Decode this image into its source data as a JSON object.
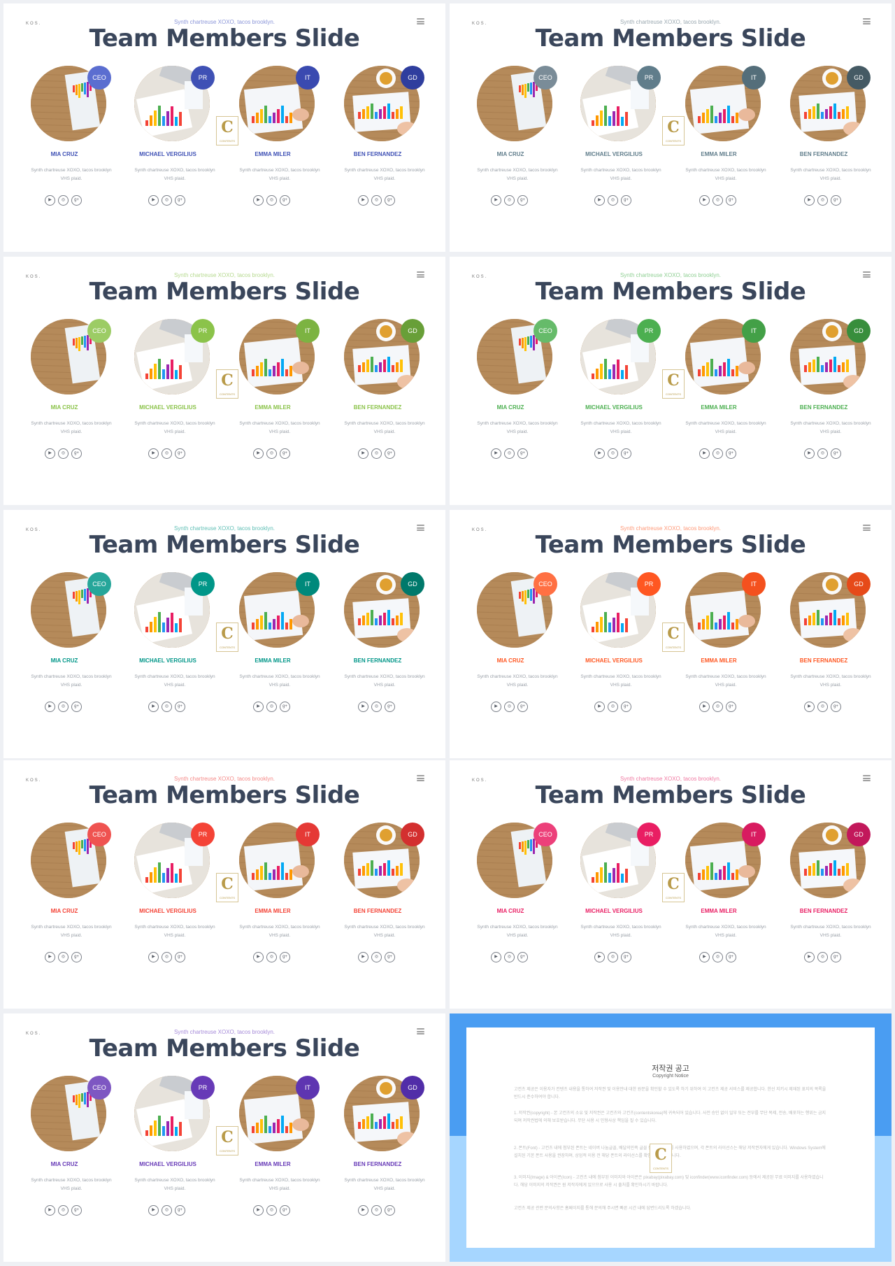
{
  "brand": "KOS.",
  "title": "Team Members Slide",
  "subtitle": "Synth chartreuse XOXO, tacos brooklyn.",
  "description": "Synth chartreuse XOXO, tacos brooklyn VHS plaid.",
  "logo": {
    "letter": "C",
    "text": "CONTENTS"
  },
  "social_icons": [
    "youtube-icon",
    "instagram-icon",
    "google-plus-icon"
  ],
  "members": [
    {
      "name": "MIA CRUZ",
      "role": "CEO"
    },
    {
      "name": "MICHAEL VERGILIUS",
      "role": "PR"
    },
    {
      "name": "EMMA MILER",
      "role": "IT"
    },
    {
      "name": "BEN FERNANDEZ",
      "role": "GD"
    }
  ],
  "slides": [
    {
      "accent": [
        "#5b6ed0",
        "#3f51b5",
        "#3a4ab0",
        "#2f3e9e"
      ],
      "subtitle_color": "#8a95d8",
      "name_color": "#3f51b5"
    },
    {
      "accent": [
        "#7a8c98",
        "#607d8b",
        "#546e7a",
        "#455a64"
      ],
      "subtitle_color": "#9aa8b0",
      "name_color": "#607d8b"
    },
    {
      "accent": [
        "#9ccc65",
        "#8bc34a",
        "#7cb342",
        "#689f38"
      ],
      "subtitle_color": "#b5d98e",
      "name_color": "#8bc34a"
    },
    {
      "accent": [
        "#66bb6a",
        "#4caf50",
        "#43a047",
        "#388e3c"
      ],
      "subtitle_color": "#8fcf93",
      "name_color": "#4caf50"
    },
    {
      "accent": [
        "#26a69a",
        "#009688",
        "#00897b",
        "#00796b"
      ],
      "subtitle_color": "#5fbfb5",
      "name_color": "#009688"
    },
    {
      "accent": [
        "#ff7043",
        "#ff5722",
        "#f4511e",
        "#e64a19"
      ],
      "subtitle_color": "#ff9a7a",
      "name_color": "#ff5722"
    },
    {
      "accent": [
        "#ef5350",
        "#f44336",
        "#e53935",
        "#d32f2f"
      ],
      "subtitle_color": "#f58a88",
      "name_color": "#f44336"
    },
    {
      "accent": [
        "#ec407a",
        "#e91e63",
        "#d81b60",
        "#c2185b"
      ],
      "subtitle_color": "#f07aa2",
      "name_color": "#e91e63"
    },
    {
      "accent": [
        "#7e57c2",
        "#673ab7",
        "#5e35b1",
        "#512da8"
      ],
      "subtitle_color": "#a58ad8",
      "name_color": "#673ab7"
    }
  ],
  "copyright": {
    "title": "저작권 공고",
    "subtitle": "Copyright Notice",
    "paragraphs": [
      "고컨츠 제공은 이용자가 컨텐츠 내용을 통하여 저작권 및 이용안내 대한 원문을 확인할 수 있도록 하기 위하여 이 고컨츠 제공 서비스를 제공합니다. 한선 지키시 제재된 표지의 목록을 반드시 준수하여야 합니다.",
      "1. 저작권(copyright) - 본 고컨츠의 소유 및 저작권은 고컨츠와 고컨츠(contentskorea)에 귀속되어 있습니다. 사전 승인 없이 일부 또는 전부를 무단 복제, 전송, 배포하는 행위는 금지되며 저작권법에 의해 보호받습니다. 무단 사용 시 민형사상 책임을 질 수 있습니다.",
      "2. 폰트(Font) - 고컨츠 내에 첨부된 폰트는 네이버 나눔글꼴, 배달의민족 글꼴 등 무료 폰트를 사용하였으며, 각 폰트의 라이선스는 해당 저작권자에게 있습니다. Windows System에 설치된 기본 폰트 사용을 권장하며, 상업적 이용 전 해당 폰트의 라이선스를 확인하시기 바랍니다.",
      "3. 이미지(Image) & 아이콘(Icon) - 고컨츠 내에 첨부된 이미지와 아이콘은 pixabay(pixabay.com) 및 iconfinder(www.iconfinder.com) 등에서 제공된 무료 이미지를 사용하였습니다. 해당 이미지의 저작권은 원 저작자에게 있으므로 사용 시 출처를 확인하시기 바랍니다.",
      "고컨츠 제공 관련 문의사항은 홈페이지를 통해 문의해 주시면 빠른 시간 내에 답변드리도록 하겠습니다."
    ]
  }
}
